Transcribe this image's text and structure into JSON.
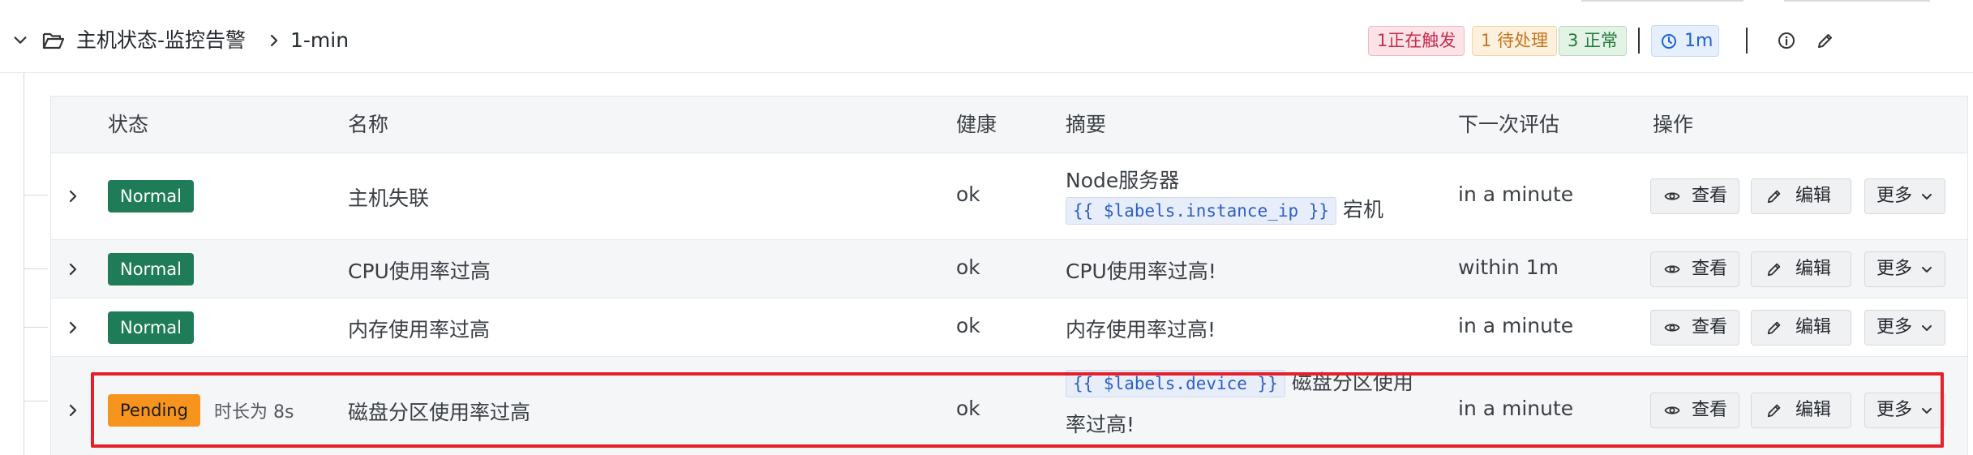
{
  "header": {
    "folder_name": "主机状态-监控告警",
    "group_name": "1-min",
    "badges": {
      "firing": "1正在触发",
      "pending": "1 待处理",
      "normal": "3 正常"
    },
    "interval": "1m",
    "icons": {
      "collapse": "chevron-down-icon",
      "folder": "folder-open-icon",
      "separator": "chevron-right-icon",
      "interval": "clock-icon",
      "info": "info-icon",
      "edit": "pencil-icon"
    }
  },
  "table": {
    "columns": {
      "state": "状态",
      "name": "名称",
      "health": "健康",
      "summary": "摘要",
      "next_eval": "下一次评估",
      "actions": "操作"
    },
    "rows": [
      {
        "state": "Normal",
        "duration": "",
        "name": "主机失联",
        "health": "ok",
        "summary_text1": "Node服务器",
        "summary_code": "{{ $labels.instance_ip }}",
        "summary_text2": "宕机",
        "next_eval": "in a minute"
      },
      {
        "state": "Normal",
        "duration": "",
        "name": "CPU使用率过高",
        "health": "ok",
        "summary_text1": "CPU使用率过高!",
        "next_eval": "within 1m"
      },
      {
        "state": "Normal",
        "duration": "",
        "name": "内存使用率过高",
        "health": "ok",
        "summary_text1": "内存使用率过高!",
        "next_eval": "in a minute"
      },
      {
        "state": "Pending",
        "duration": "时长为 8s",
        "name": "磁盘分区使用率过高",
        "health": "ok",
        "summary_code": "{{ $labels.device }}",
        "summary_text1": "磁盘分区使用",
        "summary_text2": "率过高!",
        "next_eval": "in a minute",
        "highlighted": true
      }
    ],
    "actions": {
      "view": "查看",
      "edit": "编辑",
      "more": "更多"
    }
  },
  "colors": {
    "normal": "#1e7d58",
    "pending": "#f7941e",
    "firing": "#c92a4a",
    "highlight": "#e5202b",
    "link_blue": "#1f62d6"
  }
}
